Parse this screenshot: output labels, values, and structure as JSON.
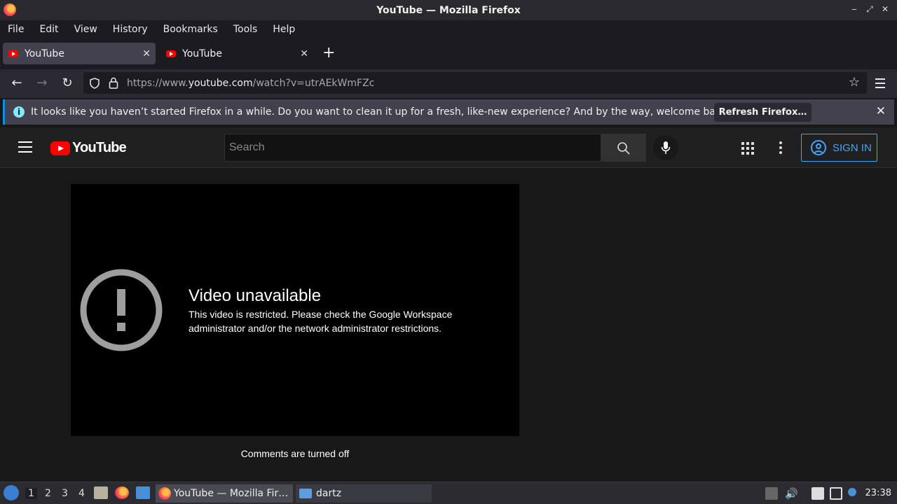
{
  "window": {
    "title": "YouTube — Mozilla Firefox"
  },
  "menu": [
    "File",
    "Edit",
    "View",
    "History",
    "Bookmarks",
    "Tools",
    "Help"
  ],
  "tabs": [
    {
      "label": "YouTube",
      "active": true
    },
    {
      "label": "YouTube",
      "active": false
    }
  ],
  "address": {
    "prefix": "https://www.",
    "domain": "youtube.com",
    "path": "/watch?v=utrAEkWmFZc"
  },
  "notice": {
    "message": "It looks like you haven’t started Firefox in a while. Do you want to clean it up for a fresh, like-new experience? And by the way, welcome back!",
    "button": "Refresh Firefox…"
  },
  "youtube": {
    "logo_text": "YouTube",
    "search_placeholder": "Search",
    "sign_in": "SIGN IN",
    "video_title": "Video unavailable",
    "video_message": "This video is restricted. Please check the Google Workspace administrator and/or the network administrator restrictions.",
    "comments": "Comments are turned off"
  },
  "taskbar": {
    "workspaces": [
      "1",
      "2",
      "3",
      "4"
    ],
    "apps": [
      {
        "label": "YouTube — Mozilla Fir…",
        "active": true
      },
      {
        "label": "dartz",
        "active": false
      }
    ],
    "clock": "23:38"
  },
  "colors": {
    "accent": "#3ea6ff",
    "youtube_red": "#ff0000",
    "info_blue": "#0090ed"
  }
}
